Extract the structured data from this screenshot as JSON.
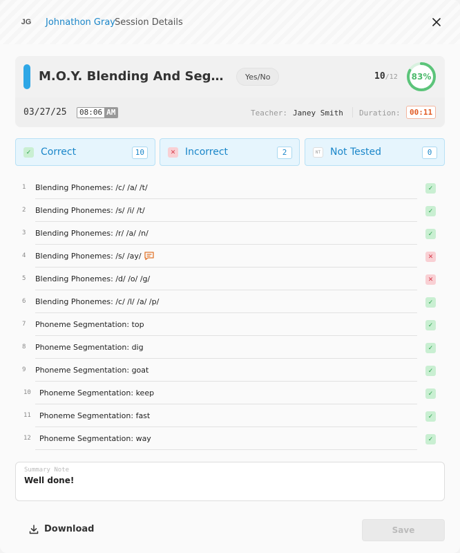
{
  "header": {
    "avatar_initials": "JG",
    "student_name": "Johnathon Gray",
    "title": "Session Details"
  },
  "assessment": {
    "title": "M.O.Y. Blending And Segmenting Phonemes",
    "type": "Yes/No",
    "score": "10",
    "score_total": "/12",
    "percent_label": "83%",
    "percent": 83,
    "date": "03/27/25",
    "time": "08:06",
    "ampm": "AM",
    "teacher_label": "Teacher:",
    "teacher_name": "Janey Smith",
    "duration_label": "Duration:",
    "duration": "00:11"
  },
  "tallies": [
    {
      "label": "Correct",
      "count": "10",
      "icon": "check-icon",
      "glyph": "✓"
    },
    {
      "label": "Incorrect",
      "count": "2",
      "icon": "x-icon",
      "glyph": "✕"
    },
    {
      "label": "Not Tested",
      "count": "0",
      "icon": "nt-icon",
      "glyph": "NT"
    }
  ],
  "items": [
    {
      "num": "1",
      "text": "Blending Phonemes: /c/ /a/ /t/",
      "result": "correct"
    },
    {
      "num": "2",
      "text": "Blending Phonemes: /s/ /i/ /t/",
      "result": "correct"
    },
    {
      "num": "3",
      "text": "Blending Phonemes: /r/ /a/ /n/",
      "result": "correct"
    },
    {
      "num": "4",
      "text": "Blending Phonemes: /s/ /ay/",
      "result": "incorrect",
      "has_comment": true
    },
    {
      "num": "5",
      "text": "Blending Phonemes: /d/ /o/ /g/",
      "result": "incorrect"
    },
    {
      "num": "6",
      "text": "Blending Phonemes: /c/ /l/ /a/ /p/",
      "result": "correct"
    },
    {
      "num": "7",
      "text": "Phoneme Segmentation: top",
      "result": "correct"
    },
    {
      "num": "8",
      "text": "Phoneme Segmentation: dig",
      "result": "correct"
    },
    {
      "num": "9",
      "text": "Phoneme Segmentation: goat",
      "result": "correct"
    },
    {
      "num": "10",
      "text": "Phoneme Segmentation: keep",
      "result": "correct"
    },
    {
      "num": "11",
      "text": "Phoneme Segmentation: fast",
      "result": "correct"
    },
    {
      "num": "12",
      "text": "Phoneme Segmentation: way",
      "result": "correct"
    }
  ],
  "summary": {
    "placeholder": "Summary Note",
    "value": "Well done!"
  },
  "footer": {
    "download_label": "Download",
    "save_label": "Save"
  },
  "colors": {
    "accent": "#2ea7e6",
    "link": "#1a86c9",
    "correct": "#2ea24f",
    "incorrect": "#d43a4a",
    "duration": "#e15a22"
  }
}
